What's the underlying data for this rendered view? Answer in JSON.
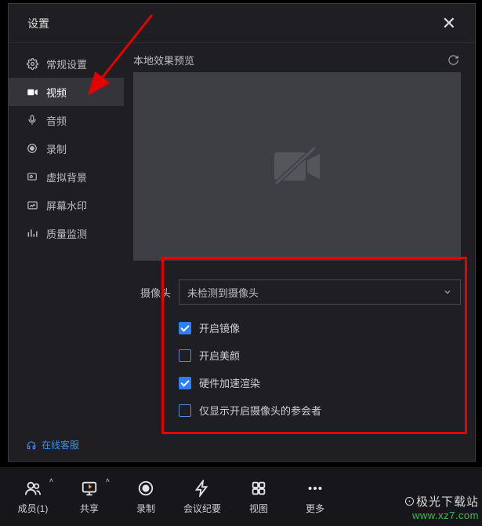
{
  "dialog": {
    "title": "设置",
    "close": "✕"
  },
  "sidebar": {
    "items": [
      {
        "label": "常规设置"
      },
      {
        "label": "视频"
      },
      {
        "label": "音频"
      },
      {
        "label": "录制"
      },
      {
        "label": "虚拟背景"
      },
      {
        "label": "屏幕水印"
      },
      {
        "label": "质量监测"
      }
    ],
    "footer": "在线客服"
  },
  "content": {
    "preview_label": "本地效果预览",
    "camera_label": "摄像头",
    "camera_value": "未检测到摄像头",
    "options": [
      {
        "label": "开启镜像",
        "checked": true
      },
      {
        "label": "开启美颜",
        "checked": false
      },
      {
        "label": "硬件加速渲染",
        "checked": true
      },
      {
        "label": "仅显示开启摄像头的参会者",
        "checked": false
      }
    ]
  },
  "toolbar": {
    "items": [
      {
        "label": "成员(1)"
      },
      {
        "label": "共享"
      },
      {
        "label": "录制"
      },
      {
        "label": "会议纪要"
      },
      {
        "label": "视图"
      },
      {
        "label": "更多"
      }
    ]
  },
  "watermark": {
    "line1": "⊙极光下载站",
    "line2": "www.xz7.com"
  }
}
